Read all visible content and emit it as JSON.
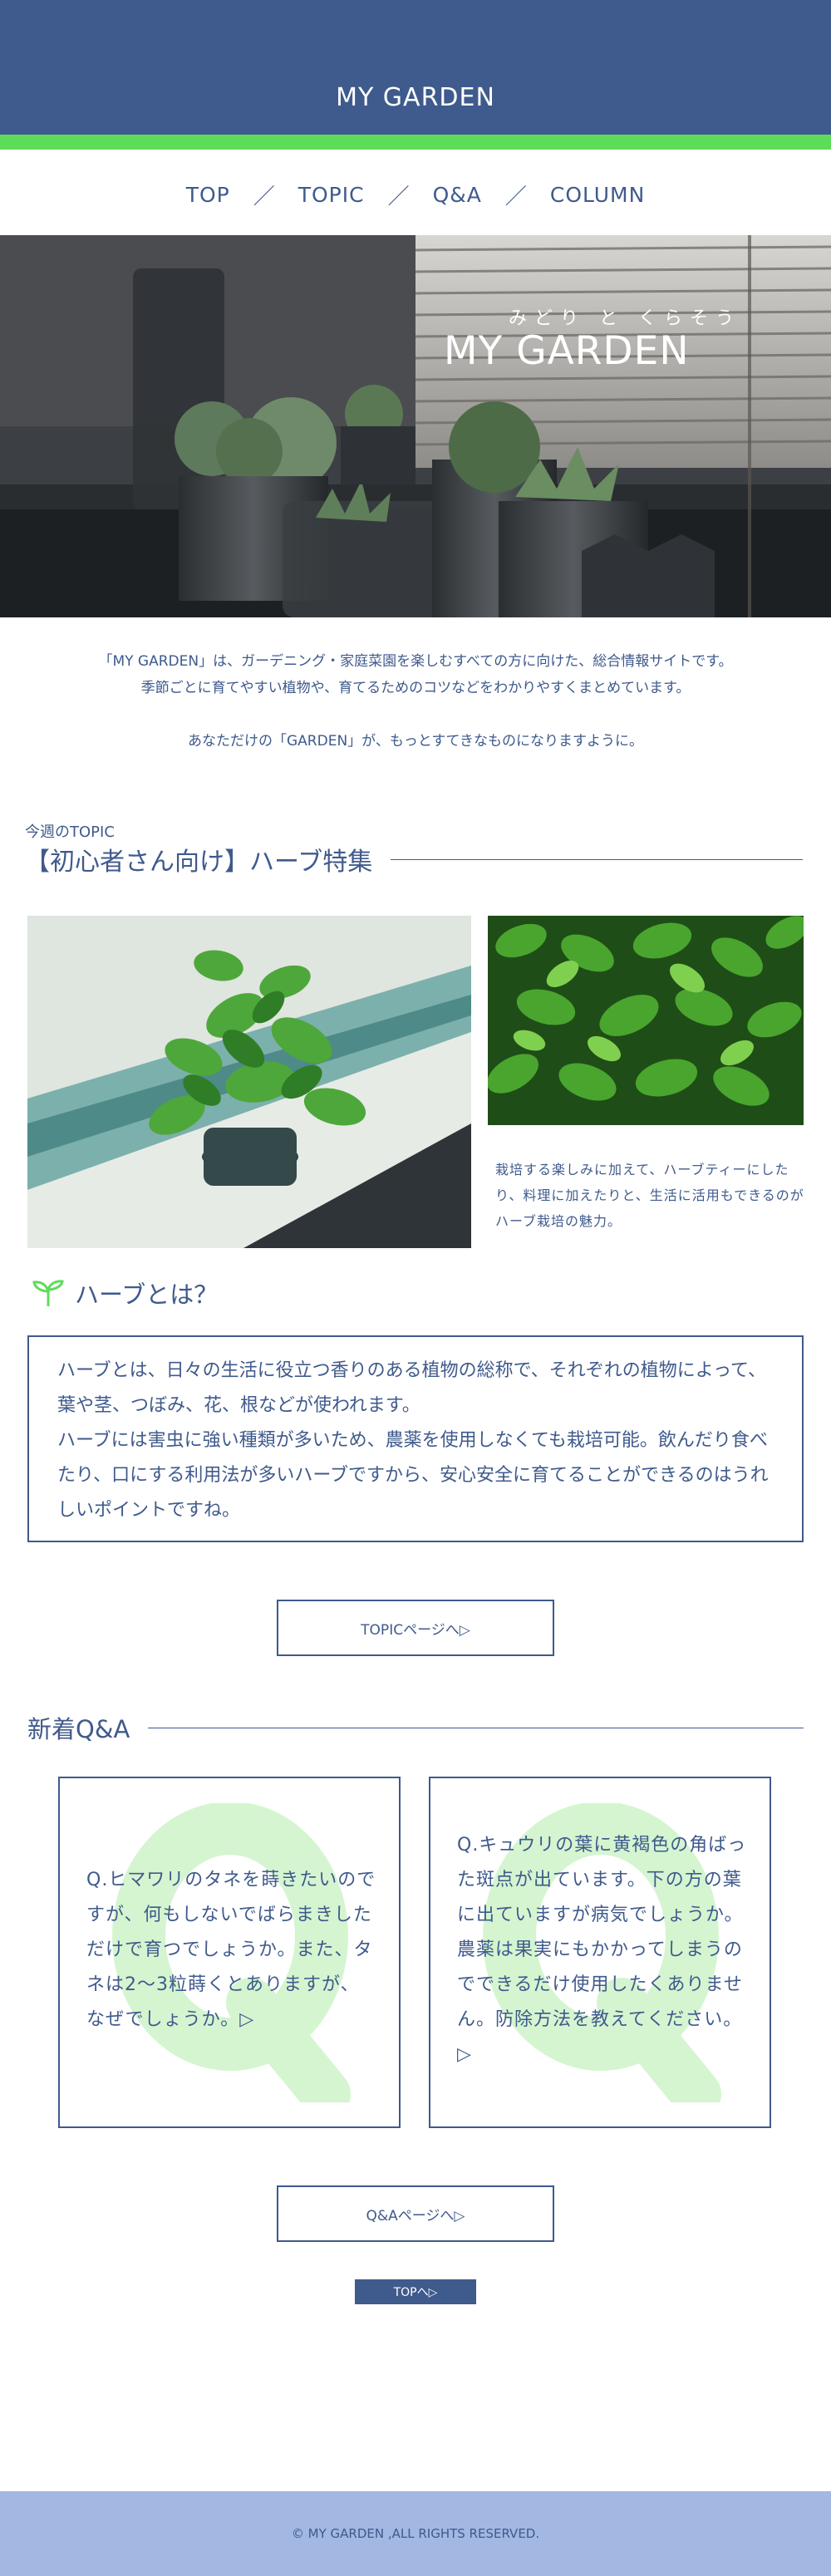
{
  "header": {
    "site_title": "MY GARDEN"
  },
  "nav": {
    "items": [
      {
        "label": "TOP"
      },
      {
        "label": "TOPIC"
      },
      {
        "label": "Q&A"
      },
      {
        "label": "COLUMN"
      }
    ],
    "separator": "／"
  },
  "hero": {
    "subtitle": "みどり と くらそう",
    "title": "MY GARDEN"
  },
  "intro": {
    "line1": "「MY GARDEN」は、ガーデニング・家庭菜園を楽しむすべての方に向けた、総合情報サイトです。",
    "line2": "季節ごとに育てやすい植物や、育てるためのコツなどをわかりやすくまとめています。",
    "line3": "あなただけの「GARDEN」が、もっとすてきなものになりますように。"
  },
  "topic": {
    "label": "今週のTOPIC",
    "title": "【初心者さん向け】ハーブ特集",
    "description": "栽培する楽しみに加えて、ハーブティーにしたり、料理に加えたりと、生活に活用もできるのがハーブ栽培の魅力。"
  },
  "herb": {
    "heading": "ハーブとは？",
    "paragraph1": "ハーブとは、日々の生活に役立つ香りのある植物の総称で、それぞれの植物によって、葉や茎、つぼみ、花、根などが使われます。",
    "paragraph2": "ハーブには害虫に強い種類が多いため、農薬を使用しなくても栽培可能。飲んだり食べたり、口にする利用法が多いハーブですから、安心安全に育てることができるのはうれしいポイントですね。"
  },
  "buttons": {
    "topic_page": "TOPICページへ▷",
    "qa_page": "Q&Aページへ▷",
    "top": "TOPへ▷"
  },
  "qa": {
    "title": "新着Q&A",
    "cards": [
      {
        "text": "Q.ヒマワリのタネを蒔きたいのですが、何もしないでばらまきしただけで育つでしょうか。また、タネは2〜3粒蒔くとありますが、なぜでしょうか。▷"
      },
      {
        "text": "Q.キュウリの葉に黄褐色の角ばった斑点が出ています。下の方の葉に出ていますが病気でしょうか。農薬は果実にもかかってしまうのでできるだけ使用したくありません。防除方法を教えてください。▷"
      }
    ]
  },
  "footer": {
    "copyright": "© MY GARDEN ,ALL RIGHTS RESERVED."
  },
  "colors": {
    "navy": "#3f5a8c",
    "green_stripe": "#5ddc5a",
    "footer_bg": "#a2b7e2",
    "qa_watermark": "#d4f5d0"
  }
}
